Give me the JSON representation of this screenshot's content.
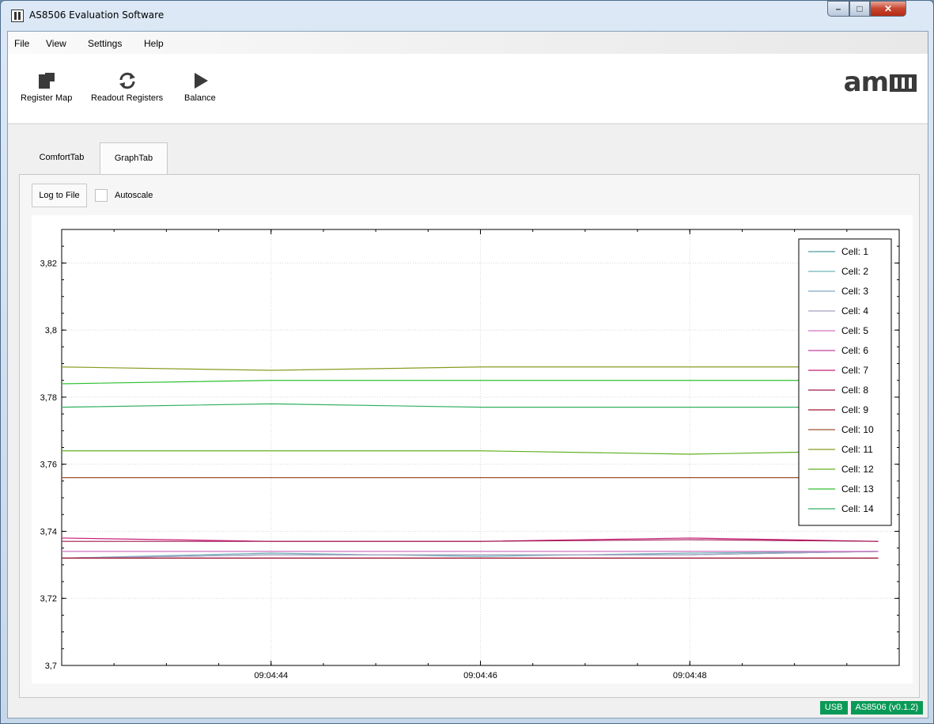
{
  "window": {
    "title": "AS8506 Evaluation Software"
  },
  "menu": [
    {
      "label": "File"
    },
    {
      "label": "View"
    },
    {
      "label": "Settings"
    },
    {
      "label": "Help"
    }
  ],
  "toolbar": {
    "register_map": "Register Map",
    "readout_registers": "Readout Registers",
    "balance": "Balance",
    "logo": "am"
  },
  "tabs": [
    {
      "label": "ComfortTab",
      "active": false
    },
    {
      "label": "GraphTab",
      "active": true
    }
  ],
  "graph_tab": {
    "log_button": "Log to File",
    "autoscale_label": "Autoscale",
    "autoscale_checked": false
  },
  "status": {
    "connection": "USB",
    "device": "AS8506 (v0.1.2)"
  },
  "colors": {
    "status_badge": "#0a9a57"
  },
  "chart_data": {
    "type": "line",
    "ylim": [
      3.7,
      3.83
    ],
    "yticks": [
      "3,7",
      "3,72",
      "3,74",
      "3,76",
      "3,78",
      "3,8",
      "3,82"
    ],
    "ytick_values": [
      3.7,
      3.72,
      3.74,
      3.76,
      3.78,
      3.8,
      3.82
    ],
    "xlim": [
      0,
      8
    ],
    "xticks": [
      "09:04:44",
      "09:04:46",
      "09:04:48"
    ],
    "xtick_values": [
      2,
      4,
      6
    ],
    "grid": true,
    "legend_position": "top-right",
    "x": [
      0,
      2,
      4,
      6,
      7.8
    ],
    "series": [
      {
        "name": "Cell: 1",
        "color": "#4f9aa0",
        "values": [
          3.732,
          3.733,
          3.733,
          3.733,
          3.734
        ]
      },
      {
        "name": "Cell: 2",
        "color": "#6fb3b8",
        "values": [
          3.732,
          3.7335,
          3.7325,
          3.7335,
          3.734
        ]
      },
      {
        "name": "Cell: 3",
        "color": "#7fa8c8",
        "values": [
          3.732,
          3.733,
          3.733,
          3.733,
          3.734
        ]
      },
      {
        "name": "Cell: 4",
        "color": "#a89fc0",
        "values": [
          3.732,
          3.733,
          3.733,
          3.733,
          3.734
        ]
      },
      {
        "name": "Cell: 5",
        "color": "#d070c0",
        "values": [
          3.734,
          3.734,
          3.734,
          3.734,
          3.734
        ]
      },
      {
        "name": "Cell: 6",
        "color": "#c040a0",
        "values": [
          3.732,
          3.732,
          3.732,
          3.732,
          3.732
        ]
      },
      {
        "name": "Cell: 7",
        "color": "#c8207a",
        "values": [
          3.738,
          3.737,
          3.737,
          3.738,
          3.737
        ]
      },
      {
        "name": "Cell: 8",
        "color": "#a01850",
        "values": [
          3.737,
          3.737,
          3.737,
          3.7375,
          3.737
        ]
      },
      {
        "name": "Cell: 9",
        "color": "#a01830",
        "values": [
          3.732,
          3.732,
          3.732,
          3.732,
          3.732
        ]
      },
      {
        "name": "Cell: 10",
        "color": "#a05030",
        "values": [
          3.756,
          3.756,
          3.756,
          3.756,
          3.756
        ]
      },
      {
        "name": "Cell: 11",
        "color": "#8a9a20",
        "values": [
          3.789,
          3.788,
          3.789,
          3.789,
          3.789
        ]
      },
      {
        "name": "Cell: 12",
        "color": "#60b020",
        "values": [
          3.764,
          3.764,
          3.764,
          3.763,
          3.764
        ]
      },
      {
        "name": "Cell: 13",
        "color": "#30c030",
        "values": [
          3.784,
          3.785,
          3.785,
          3.785,
          3.785
        ]
      },
      {
        "name": "Cell: 14",
        "color": "#30b060",
        "values": [
          3.777,
          3.778,
          3.777,
          3.777,
          3.777
        ]
      }
    ]
  }
}
